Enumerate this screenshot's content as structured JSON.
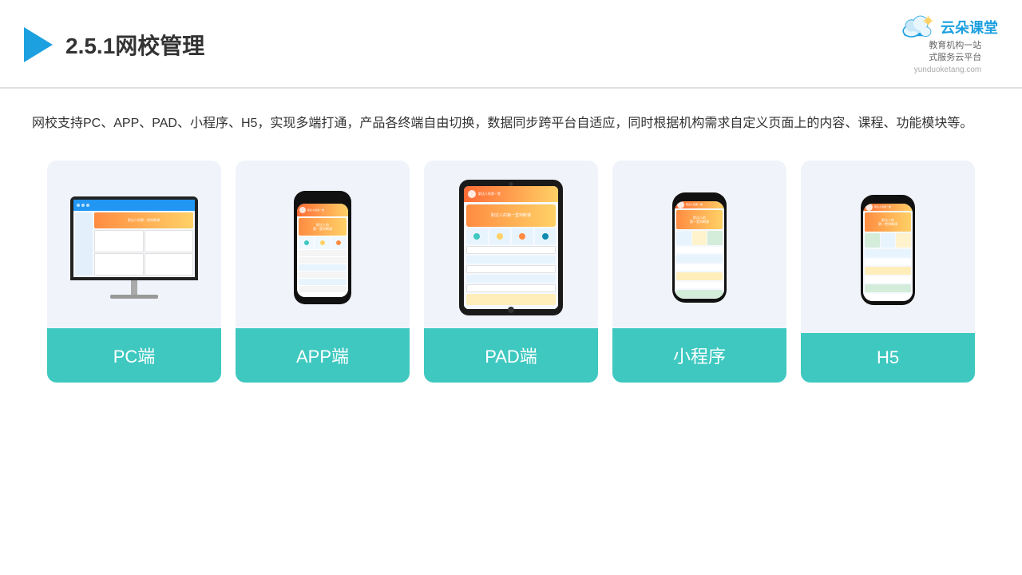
{
  "header": {
    "title": "2.5.1网校管理",
    "brand": {
      "name": "云朵课堂",
      "slogan": "教育机构一站\n式服务云平台",
      "url": "yunduoketang.com"
    }
  },
  "description": "网校支持PC、APP、PAD、小程序、H5，实现多端打通，产品各终端自由切换，数据同步跨平台自适应，同时根据机构需求自定义页面上的内容、课程、功能模块等。",
  "cards": [
    {
      "id": "pc",
      "label": "PC端"
    },
    {
      "id": "app",
      "label": "APP端"
    },
    {
      "id": "pad",
      "label": "PAD端"
    },
    {
      "id": "miniprogram",
      "label": "小程序"
    },
    {
      "id": "h5",
      "label": "H5"
    }
  ],
  "colors": {
    "accent": "#3ec8c0",
    "header_border": "#e0e0e0",
    "card_bg": "#f0f4fa",
    "title_color": "#333333",
    "brand_blue": "#1da0e0"
  }
}
